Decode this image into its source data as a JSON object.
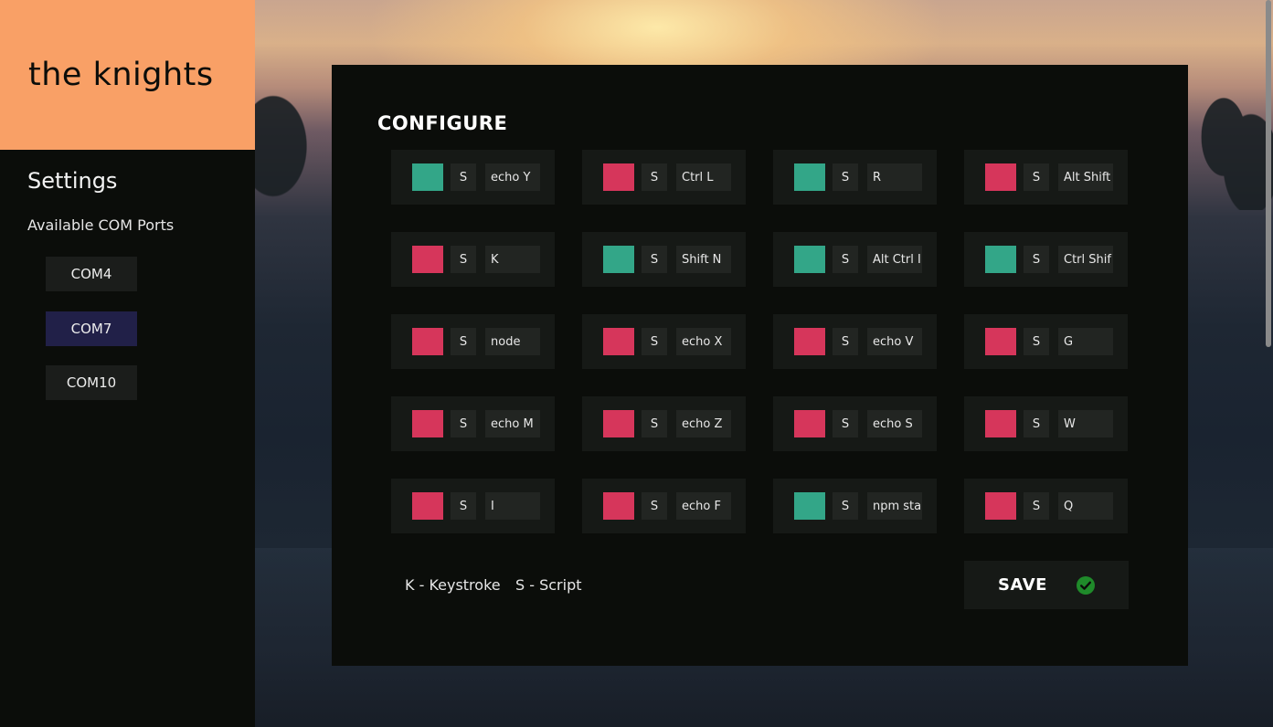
{
  "app": {
    "brand": "the knights"
  },
  "sidebar": {
    "title": "Settings",
    "ports_label": "Available COM Ports",
    "ports": [
      {
        "label": "COM4",
        "active": false
      },
      {
        "label": "COM7",
        "active": true
      },
      {
        "label": "COM10",
        "active": false
      }
    ]
  },
  "main": {
    "title": "CONFIGURE",
    "legend": {
      "keystroke": "K - Keystroke",
      "script": "S - Script"
    },
    "save_label": "SAVE"
  },
  "colors": {
    "green": "#33a688",
    "red": "#d6365b",
    "brand": "#f9a066",
    "active_port": "#212048",
    "save_check": "#1f8a2a"
  },
  "keys": [
    {
      "color": "green",
      "mode": "S",
      "command": "echo Y"
    },
    {
      "color": "red",
      "mode": "S",
      "command": "Ctrl L"
    },
    {
      "color": "green",
      "mode": "S",
      "command": "R"
    },
    {
      "color": "red",
      "mode": "S",
      "command": "Alt Shift"
    },
    {
      "color": "red",
      "mode": "S",
      "command": "K"
    },
    {
      "color": "green",
      "mode": "S",
      "command": "Shift N"
    },
    {
      "color": "green",
      "mode": "S",
      "command": "Alt Ctrl I"
    },
    {
      "color": "green",
      "mode": "S",
      "command": "Ctrl Shif"
    },
    {
      "color": "red",
      "mode": "S",
      "command": "node"
    },
    {
      "color": "red",
      "mode": "S",
      "command": "echo X"
    },
    {
      "color": "red",
      "mode": "S",
      "command": "echo V"
    },
    {
      "color": "red",
      "mode": "S",
      "command": "G"
    },
    {
      "color": "red",
      "mode": "S",
      "command": "echo M"
    },
    {
      "color": "red",
      "mode": "S",
      "command": "echo Z"
    },
    {
      "color": "red",
      "mode": "S",
      "command": "echo S"
    },
    {
      "color": "red",
      "mode": "S",
      "command": "W"
    },
    {
      "color": "red",
      "mode": "S",
      "command": "I"
    },
    {
      "color": "red",
      "mode": "S",
      "command": "echo F"
    },
    {
      "color": "green",
      "mode": "S",
      "command": "npm sta"
    },
    {
      "color": "red",
      "mode": "S",
      "command": "Q"
    }
  ]
}
